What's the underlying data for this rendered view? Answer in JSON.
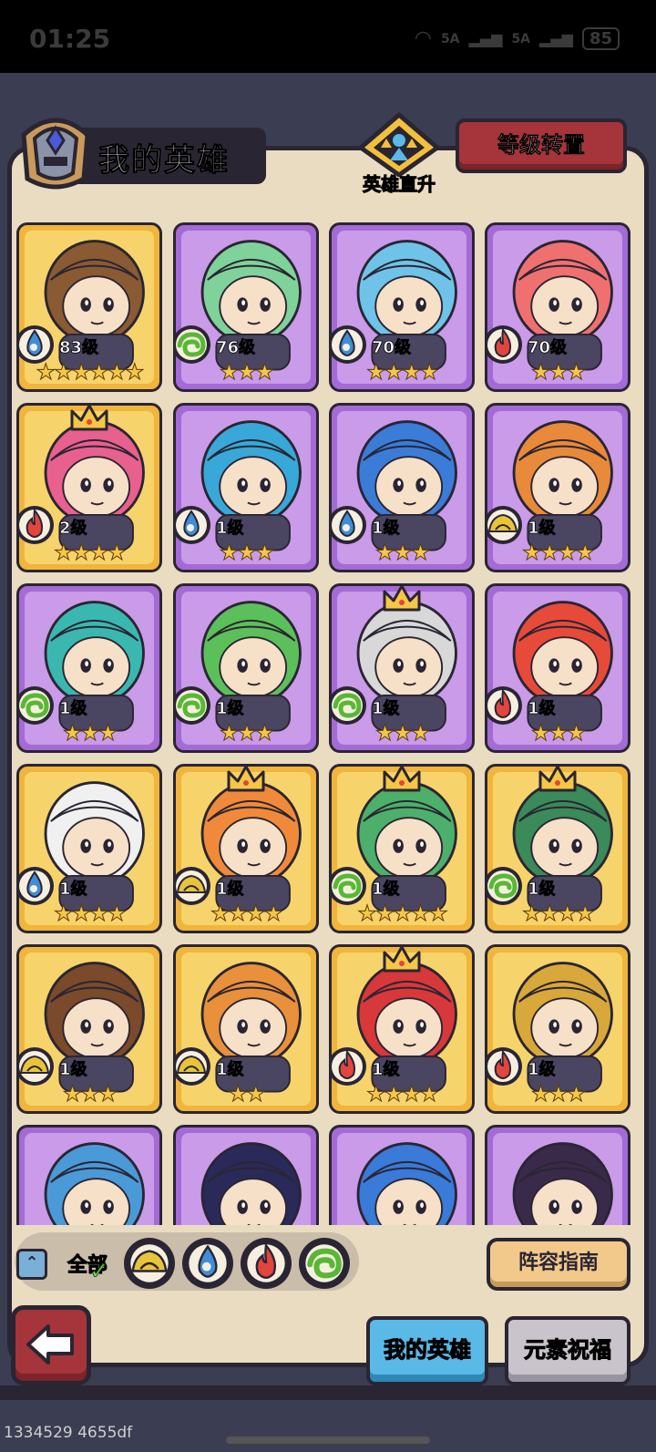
{
  "status_bar": {
    "time": "01:25",
    "signal1": "5A",
    "signal2": "5A",
    "battery": "85"
  },
  "header": {
    "title": "我的英雄",
    "direct_up_label": "英雄直升",
    "level_transfer_label": "等级转置"
  },
  "colors": {
    "water": "#3e8ed8",
    "wood": "#58b834",
    "fire": "#e2453e",
    "earth": "#e8c43a",
    "gold_frame": "#f0b53a",
    "purple_frame": "#a46ad6"
  },
  "heroes": [
    {
      "element": "water",
      "level": "83级",
      "stars": "★★★★★★",
      "frame": "gold",
      "crown": false,
      "skin": "#8a5a32"
    },
    {
      "element": "wood",
      "level": "76级",
      "stars": "★★★",
      "frame": "purple",
      "crown": false,
      "skin": "#7fd39a"
    },
    {
      "element": "water",
      "level": "70级",
      "stars": "★★★★",
      "frame": "purple",
      "crown": false,
      "skin": "#6fc3e8"
    },
    {
      "element": "fire",
      "level": "70级",
      "stars": "★★★",
      "frame": "purple",
      "crown": false,
      "skin": "#f07070"
    },
    {
      "element": "fire",
      "level": "2级",
      "stars": "★★★★",
      "frame": "gold",
      "crown": true,
      "skin": "#e8608e"
    },
    {
      "element": "water",
      "level": "1级",
      "stars": "★★★",
      "frame": "purple",
      "crown": false,
      "skin": "#38a8d8"
    },
    {
      "element": "water",
      "level": "1级",
      "stars": "★★★",
      "frame": "purple",
      "crown": false,
      "skin": "#3a7cd8"
    },
    {
      "element": "earth",
      "level": "1级",
      "stars": "★★★★",
      "frame": "purple",
      "crown": false,
      "skin": "#e88a3a"
    },
    {
      "element": "wood",
      "level": "1级",
      "stars": "★★★",
      "frame": "purple",
      "crown": false,
      "skin": "#3ab8b0"
    },
    {
      "element": "wood",
      "level": "1级",
      "stars": "★★★",
      "frame": "purple",
      "crown": false,
      "skin": "#5cc05a"
    },
    {
      "element": "wood",
      "level": "1级",
      "stars": "★★★",
      "frame": "purple",
      "crown": true,
      "skin": "#d8d8d8"
    },
    {
      "element": "fire",
      "level": "1级",
      "stars": "★★★",
      "frame": "purple",
      "crown": false,
      "skin": "#e84a3a"
    },
    {
      "element": "water",
      "level": "1级",
      "stars": "★★★★",
      "frame": "gold",
      "crown": false,
      "skin": "#f0f0f0"
    },
    {
      "element": "earth",
      "level": "1级",
      "stars": "★★★★",
      "frame": "gold",
      "crown": true,
      "skin": "#f08a3a"
    },
    {
      "element": "wood",
      "level": "1级",
      "stars": "★★★★★",
      "frame": "gold",
      "crown": true,
      "skin": "#4cb06a"
    },
    {
      "element": "wood",
      "level": "1级",
      "stars": "★★★★",
      "frame": "gold",
      "crown": true,
      "skin": "#3a8a5a"
    },
    {
      "element": "earth",
      "level": "1级",
      "stars": "★★★",
      "frame": "gold",
      "crown": false,
      "skin": "#7a4a2a"
    },
    {
      "element": "earth",
      "level": "1级",
      "stars": "★★",
      "frame": "gold",
      "crown": false,
      "skin": "#e8903a"
    },
    {
      "element": "fire",
      "level": "1级",
      "stars": "★★★★",
      "frame": "gold",
      "crown": true,
      "skin": "#d8383a"
    },
    {
      "element": "fire",
      "level": "1级",
      "stars": "★★★",
      "frame": "gold",
      "crown": false,
      "skin": "#d8a83a"
    },
    {
      "element": "",
      "level": "",
      "stars": "",
      "frame": "purple",
      "crown": false,
      "skin": "#4a9ad8"
    },
    {
      "element": "",
      "level": "",
      "stars": "",
      "frame": "purple",
      "crown": false,
      "skin": "#2a2a5a"
    },
    {
      "element": "",
      "level": "",
      "stars": "",
      "frame": "purple",
      "crown": false,
      "skin": "#3a7ad8"
    },
    {
      "element": "",
      "level": "",
      "stars": "",
      "frame": "purple",
      "crown": false,
      "skin": "#3a2a4a"
    }
  ],
  "filters": {
    "all_label": "全部",
    "elements": [
      "earth",
      "water",
      "fire",
      "wood"
    ]
  },
  "guide_button": "阵容指南",
  "tabs": {
    "my_heroes": "我的英雄",
    "element_blessing": "元素祝福"
  },
  "debug_text": "1334529 4655df"
}
